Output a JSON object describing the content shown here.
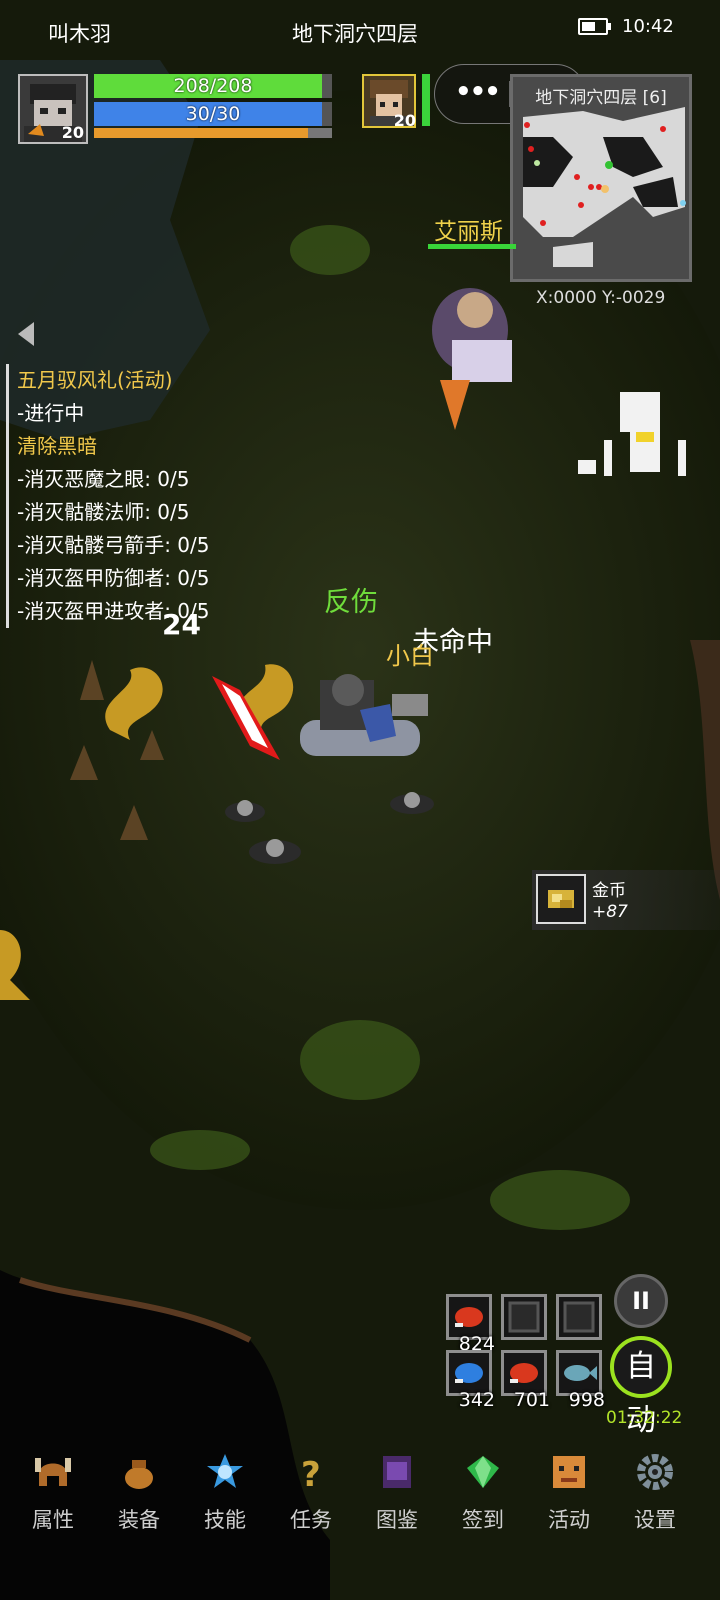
{
  "status": {
    "player_name": "叫木羽",
    "location_title": "地下洞穴四层",
    "time": "10:42",
    "battery": 0.6
  },
  "player": {
    "level": "20",
    "hp_text": "208/208",
    "hp_fraction": 1.0,
    "mp_text": "30/30",
    "mp_fraction": 1.0,
    "xp_fraction": 0.9
  },
  "ally": {
    "name": "艾丽斯",
    "level": "20",
    "hp_fraction": 1.0
  },
  "minimap": {
    "title": "地下洞穴四层 [6]",
    "coords": "X:0000  Y:-0029"
  },
  "quest": {
    "event_title": "五月驭风礼(活动)",
    "event_status": "-进行中",
    "quest_title": "清除黑暗",
    "objectives": [
      "-消灭恶魔之眼: 0/5",
      "-消灭骷髅法师: 0/5",
      "-消灭骷髅弓箭手: 0/5",
      "-消灭盔甲防御者: 0/5",
      "-消灭盔甲进攻者: 0/5"
    ]
  },
  "combat_text": {
    "reflect": "反伤",
    "miss": "未命中",
    "pet_name": "小白",
    "damage": "24"
  },
  "pickup": {
    "name": "金币",
    "amount": "+87"
  },
  "hotbar": [
    {
      "icon": "red-meat-icon",
      "count": "824"
    },
    {
      "icon": "empty-slot",
      "count": ""
    },
    {
      "icon": "empty-slot",
      "count": ""
    },
    {
      "icon": "blue-meat-icon",
      "count": "342"
    },
    {
      "icon": "red-meat-icon",
      "count": "701"
    },
    {
      "icon": "fish-icon",
      "count": "998"
    }
  ],
  "controls": {
    "pause": "II",
    "auto": "自动",
    "timer": "01:32:22"
  },
  "nav": [
    "属性",
    "装备",
    "技能",
    "任务",
    "图鉴",
    "签到",
    "活动",
    "设置"
  ],
  "colors": {
    "hp": "#5fdc3b",
    "mp": "#3f83e8",
    "xp": "#e79a2c",
    "gold_text": "#f1c84b",
    "auto_ring": "#9be21f"
  }
}
